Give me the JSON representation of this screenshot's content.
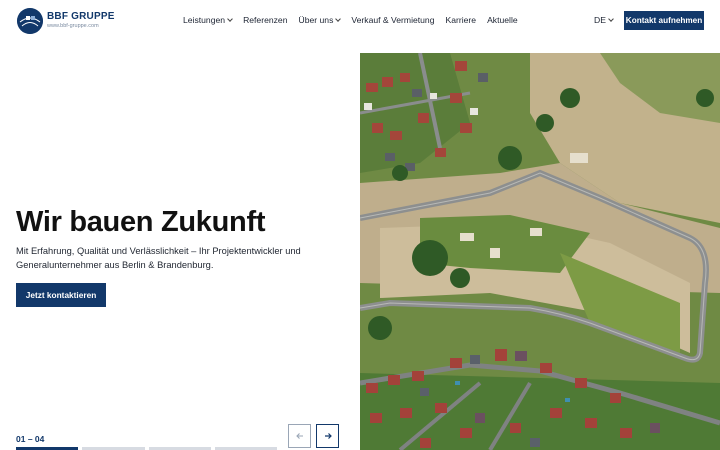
{
  "brand": {
    "name": "BBF GRUPPE",
    "url": "www.bbf-gruppe.com",
    "color": "#12386a"
  },
  "nav": {
    "items": [
      {
        "label": "Leistungen",
        "dropdown": true
      },
      {
        "label": "Referenzen",
        "dropdown": false
      },
      {
        "label": "Über uns",
        "dropdown": true
      },
      {
        "label": "Verkauf & Vermietung",
        "dropdown": false
      },
      {
        "label": "Karriere",
        "dropdown": false
      },
      {
        "label": "Aktuelle",
        "dropdown": false
      }
    ],
    "language": "DE",
    "cta": "Kontakt aufnehmen"
  },
  "hero": {
    "title": "Wir bauen Zukunft",
    "subtitle": "Mit Erfahrung, Qualität und Verlässlichkeit – Ihr Projektentwickler und Generalunternehmer aus Berlin & Brandenburg.",
    "button": "Jetzt kontaktieren",
    "slide_counter": "01 – 04",
    "current_slide": 1,
    "total_slides": 4,
    "prev_icon": "arrow-left-icon",
    "next_icon": "arrow-right-icon",
    "image": "aerial-photo-housing-development"
  }
}
